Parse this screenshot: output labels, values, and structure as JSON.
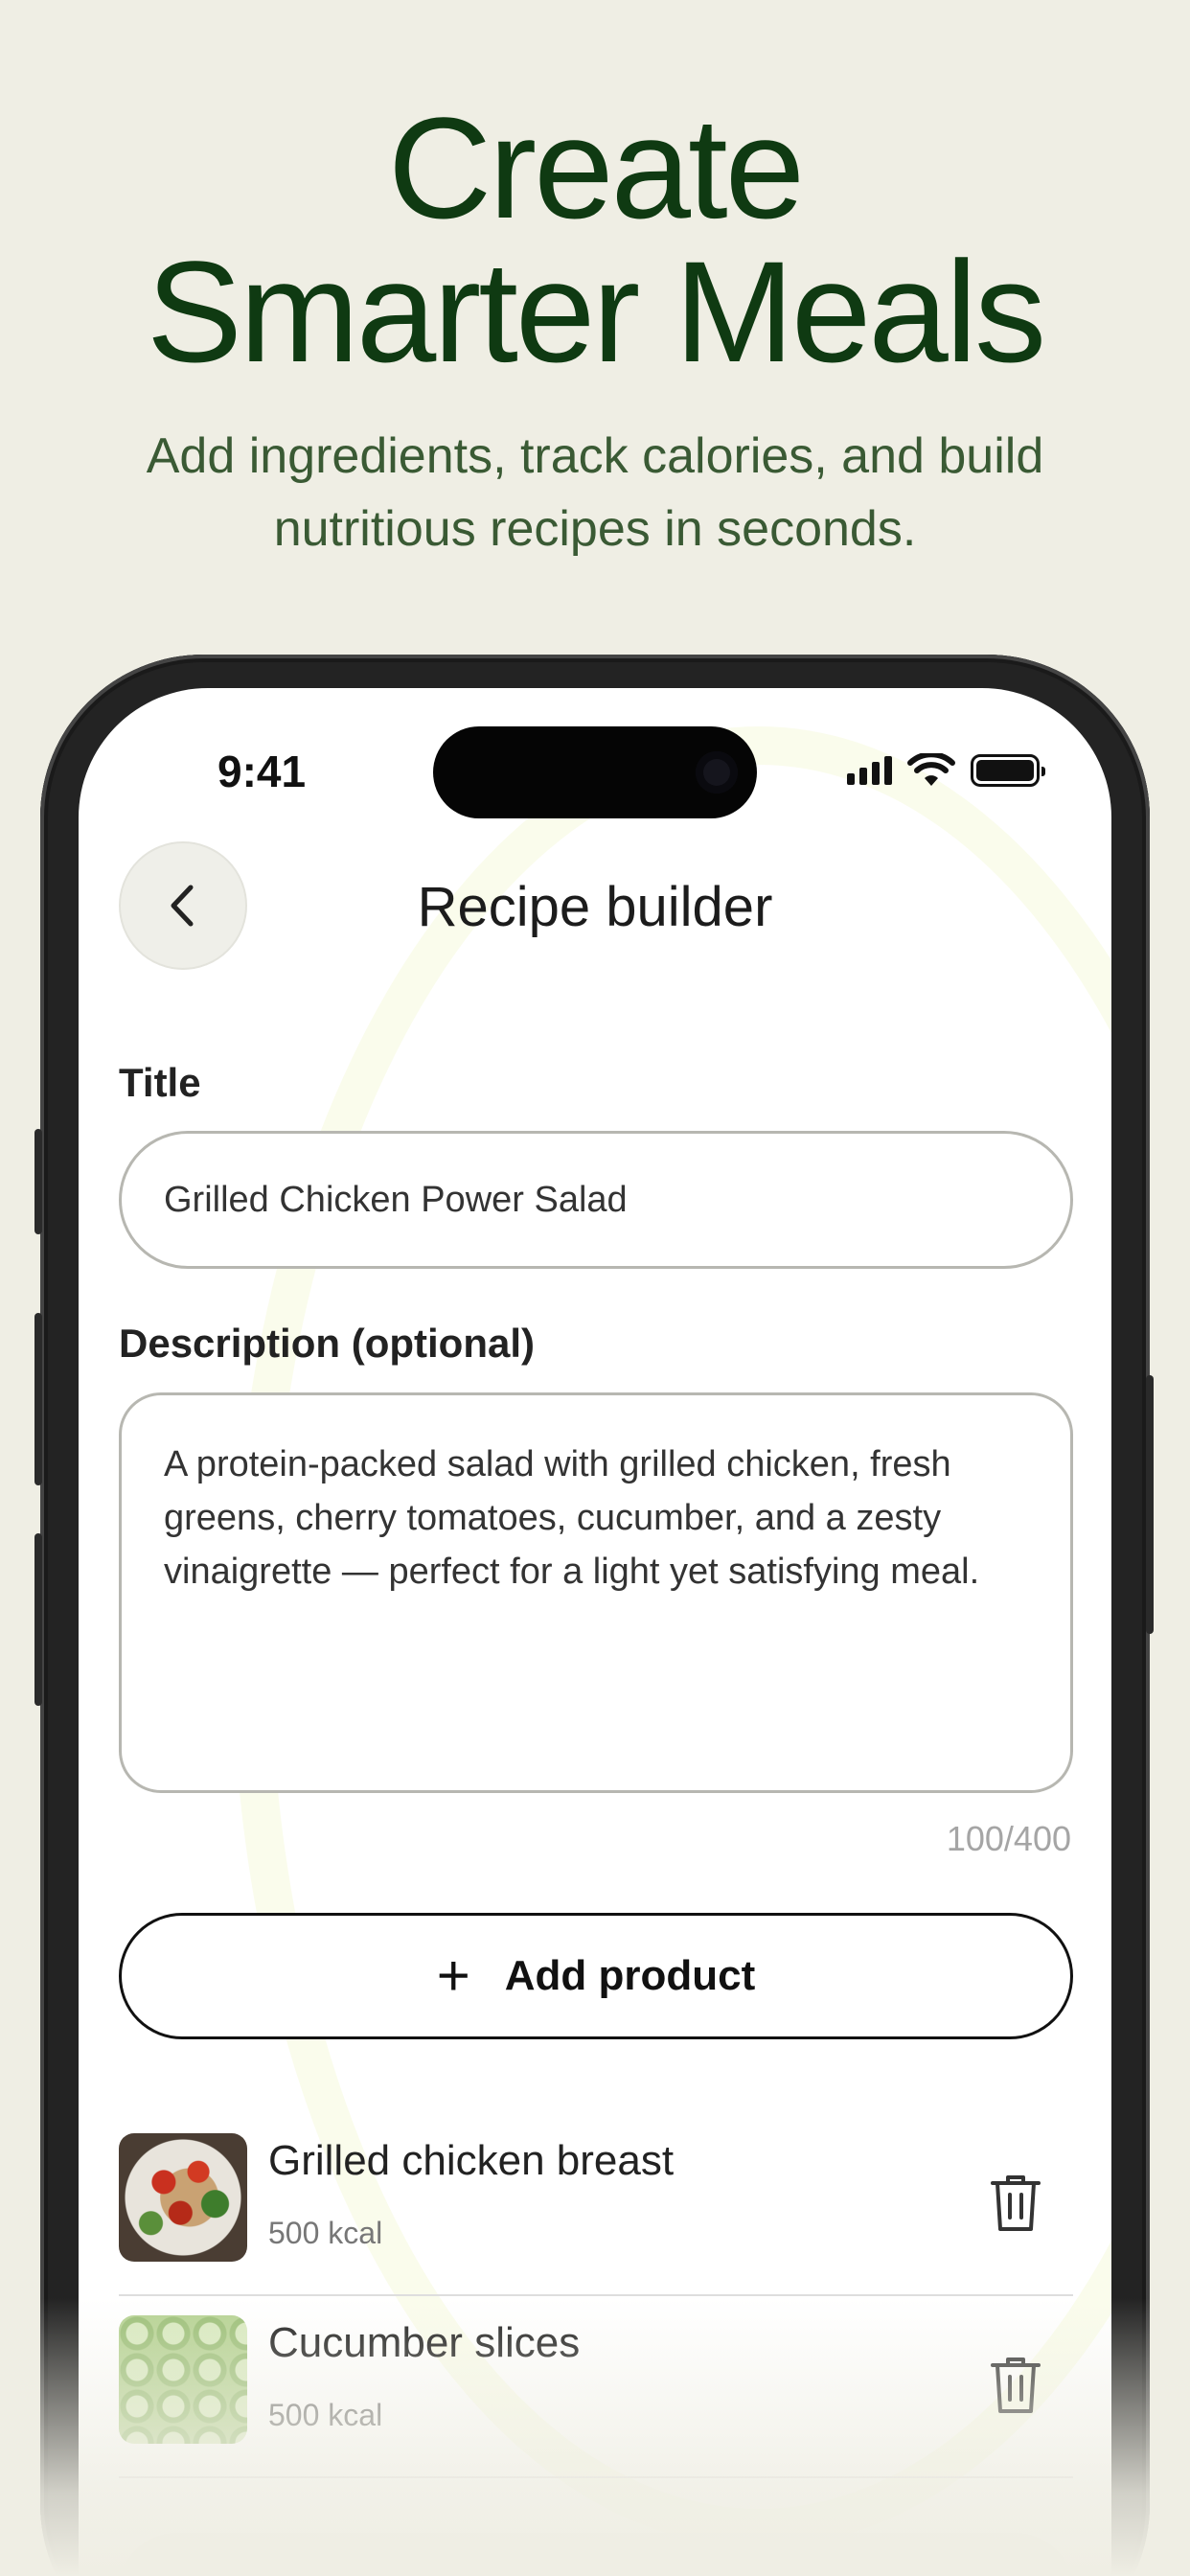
{
  "hero": {
    "title_line1": "Create",
    "title_line2": "Smarter Meals",
    "subtitle": "Add ingredients, track calories, and build nutritious recipes in seconds."
  },
  "status_bar": {
    "time": "9:41"
  },
  "header": {
    "title": "Recipe builder"
  },
  "form": {
    "title_label": "Title",
    "title_value": "Grilled Chicken Power Salad",
    "description_label": "Description (optional)",
    "description_value": "A protein-packed salad with grilled chicken, fresh greens, cherry tomatoes, cucumber, and a zesty vinaigrette — perfect for a light yet satisfying meal.",
    "char_counter": "100/400"
  },
  "add_product": {
    "icon": "plus-icon",
    "label": "Add product"
  },
  "products": [
    {
      "name": "Grilled chicken breast",
      "kcal": "500 kcal",
      "image": "chicken-salad-thumbnail"
    },
    {
      "name": "Cucumber slices",
      "kcal": "500 kcal",
      "image": "cucumber-thumbnail"
    }
  ],
  "colors": {
    "background": "#efeee4",
    "hero_title": "#0f3a12",
    "hero_subtitle": "#3a5a34"
  }
}
